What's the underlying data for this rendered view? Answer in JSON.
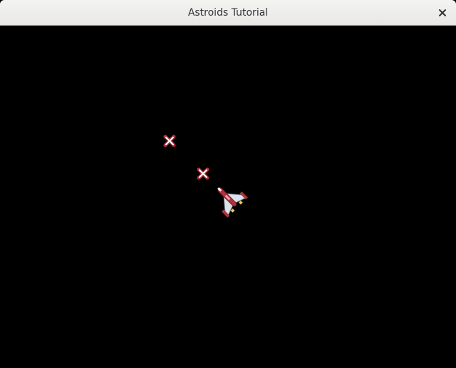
{
  "window": {
    "title": "Astroids Tutorial",
    "close_icon": "close-icon"
  },
  "game": {
    "background_color": "#000000",
    "ship": {
      "icon": "spaceship-icon",
      "hull_color": "#d8e4ea",
      "accent_color": "#b3313a",
      "engine_color": "#f2c94c"
    },
    "missiles": [
      {
        "icon": "missile-x-icon",
        "color": "#b3313a"
      },
      {
        "icon": "missile-x-icon",
        "color": "#b3313a"
      }
    ]
  }
}
